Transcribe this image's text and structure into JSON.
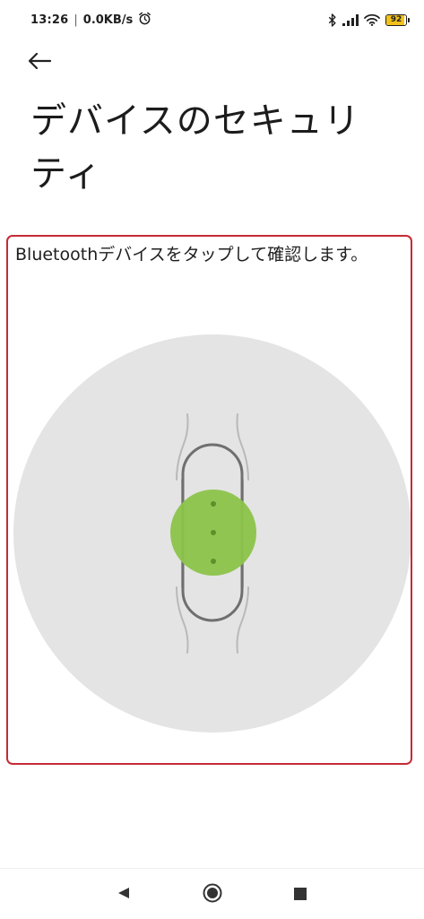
{
  "status_bar": {
    "time": "13:26",
    "separator": "|",
    "network_speed": "0.0KB/s",
    "icons": [
      "alarm-icon",
      "bluetooth-icon",
      "signal-icon",
      "wifi-icon",
      "battery-icon"
    ],
    "battery_level": "92",
    "battery_fraction": 0.92
  },
  "header": {
    "back_icon": "back-arrow-icon",
    "title": "デバイスのセキュリティ"
  },
  "panel": {
    "instruction": "Bluetoothデバイスをタップして確認します。",
    "illustration": "fitness-band-tap",
    "colors": {
      "border": "#c42b36",
      "circle": "#e4e4e4",
      "tap_highlight": "#8bc34a"
    }
  },
  "nav_bar": {
    "buttons": [
      "nav-back-icon",
      "nav-home-icon",
      "nav-recents-icon"
    ]
  }
}
